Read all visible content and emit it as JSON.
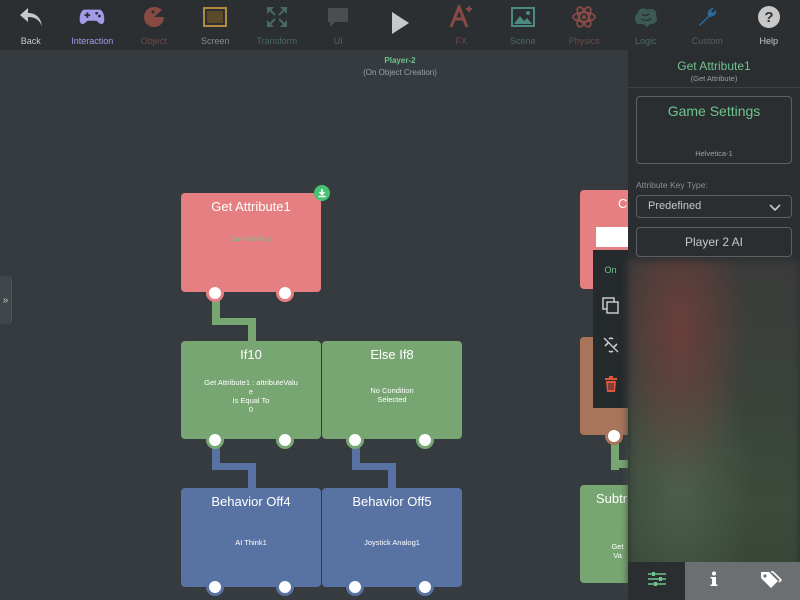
{
  "toolbar": [
    {
      "label": "Back",
      "icon": "back-arrow-icon",
      "state": "normal"
    },
    {
      "label": "Interaction",
      "icon": "gamepad-icon",
      "state": "active"
    },
    {
      "label": "Object",
      "icon": "pacman-icon",
      "state": "red"
    },
    {
      "label": "Screen",
      "icon": "screen-icon",
      "state": "normal"
    },
    {
      "label": "Transform",
      "icon": "expand-icon",
      "state": "teal"
    },
    {
      "label": "UI",
      "icon": "chat-bubble-icon",
      "state": "dim"
    },
    {
      "label": "",
      "icon": "play-icon",
      "state": "normal"
    },
    {
      "label": "FX",
      "icon": "fx-icon",
      "state": "red"
    },
    {
      "label": "Scene",
      "icon": "picture-icon",
      "state": "teal"
    },
    {
      "label": "Physics",
      "icon": "atom-icon",
      "state": "red"
    },
    {
      "label": "Logic",
      "icon": "brain-icon",
      "state": "teal"
    },
    {
      "label": "Custom",
      "icon": "wrench-icon",
      "state": "dim"
    },
    {
      "label": "Help",
      "icon": "question-icon",
      "state": "normal"
    }
  ],
  "canvas": {
    "object_name": "Player-2",
    "event_name": "(On Object Creation)"
  },
  "nodes": {
    "get_attribute": {
      "title": "Get Attribute1",
      "body": "Game Settings"
    },
    "if10": {
      "title": "If10",
      "body": "Get Attribute1 : attributeValu\ne\nIs Equal To\n0"
    },
    "else_if8": {
      "title": "Else If8",
      "body": "No Condition\nSelected"
    },
    "behavior_off4": {
      "title": "Behavior Off4",
      "body": "AI Think1"
    },
    "behavior_off5": {
      "title": "Behavior Off5",
      "body": "Joystick Analog1"
    },
    "partial_red": {
      "title": "C"
    },
    "partial_green": {
      "title": "Subtr",
      "body": "Get Va"
    }
  },
  "context_menu": {
    "on_label": "On",
    "items": [
      "copy-icon",
      "unlink-icon",
      "trash-icon"
    ]
  },
  "panel": {
    "title": "Get Attribute1",
    "subtitle": "(Get Attribute)",
    "source_title": "Game Settings",
    "source_font": "Helvetica-1",
    "key_type_label": "Attribute Key Type:",
    "key_type_value": "Predefined",
    "key_value": "Player 2 AI",
    "tabs": [
      "sliders-icon",
      "info-icon",
      "tags-icon"
    ]
  },
  "colors": {
    "accent_green": "#6ec48d",
    "node_red": "#e57f82",
    "node_green": "#78a672",
    "node_blue": "#5873a3",
    "active_tab": "#a59ae8"
  }
}
